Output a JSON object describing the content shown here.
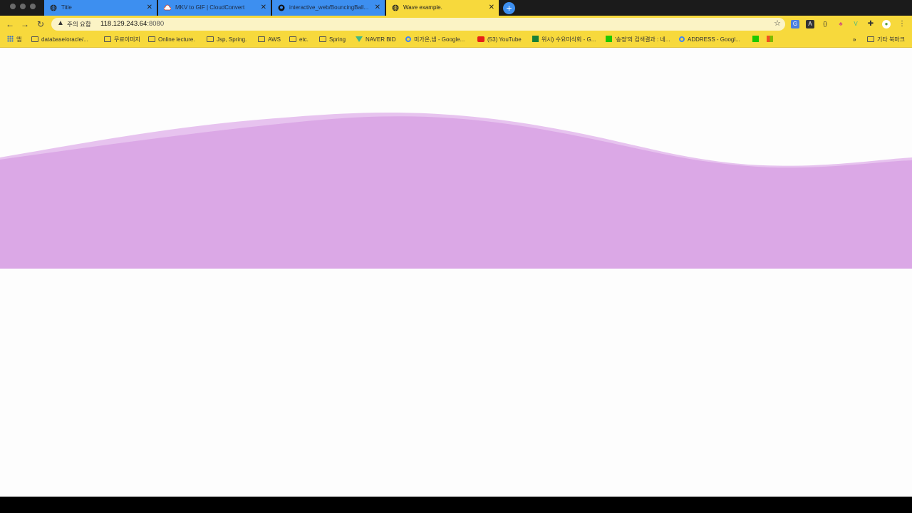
{
  "tabs": [
    {
      "title": "Title",
      "icon": "globe-icon"
    },
    {
      "title": "MKV to GIF | CloudConvert",
      "icon": "cloud-icon"
    },
    {
      "title": "interactive_web/BouncingBall...",
      "icon": "github-icon"
    },
    {
      "title": "Wave example.",
      "icon": "globe-icon",
      "active": true
    }
  ],
  "toolbar": {
    "security_warning": "주의 요함",
    "url_host": "118.129.243.64",
    "url_port": ":8080"
  },
  "bookmarks": {
    "apps_label": "앱",
    "items": [
      {
        "label": "database/oracle/...",
        "icon": "folder-icon"
      },
      {
        "label": "무료이미지",
        "icon": "folder-icon"
      },
      {
        "label": "Online lecture.",
        "icon": "folder-icon"
      },
      {
        "label": "Jsp, Spring.",
        "icon": "folder-icon"
      },
      {
        "label": "AWS",
        "icon": "folder-icon"
      },
      {
        "label": "etc.",
        "icon": "folder-icon"
      },
      {
        "label": "Spring",
        "icon": "folder-icon"
      },
      {
        "label": "NAVER BID",
        "icon": "vue-icon"
      },
      {
        "label": "미가온,냅 - Google...",
        "icon": "google-icon"
      },
      {
        "label": "(53) YouTube",
        "icon": "youtube-icon"
      },
      {
        "label": "위시) 수요미식회 - G...",
        "icon": "sheet-icon"
      },
      {
        "label": "'송정'의 검색결과 : 네...",
        "icon": "naver-icon"
      },
      {
        "label": "ADDRESS - Googl...",
        "icon": "google-icon"
      }
    ],
    "other_label": "기타 북마크"
  },
  "colors": {
    "wave": "#dba8e6",
    "wave_edge": "#e7c3ef",
    "tab_inactive": "#3d8ff0",
    "tab_active": "#f7d93c"
  }
}
